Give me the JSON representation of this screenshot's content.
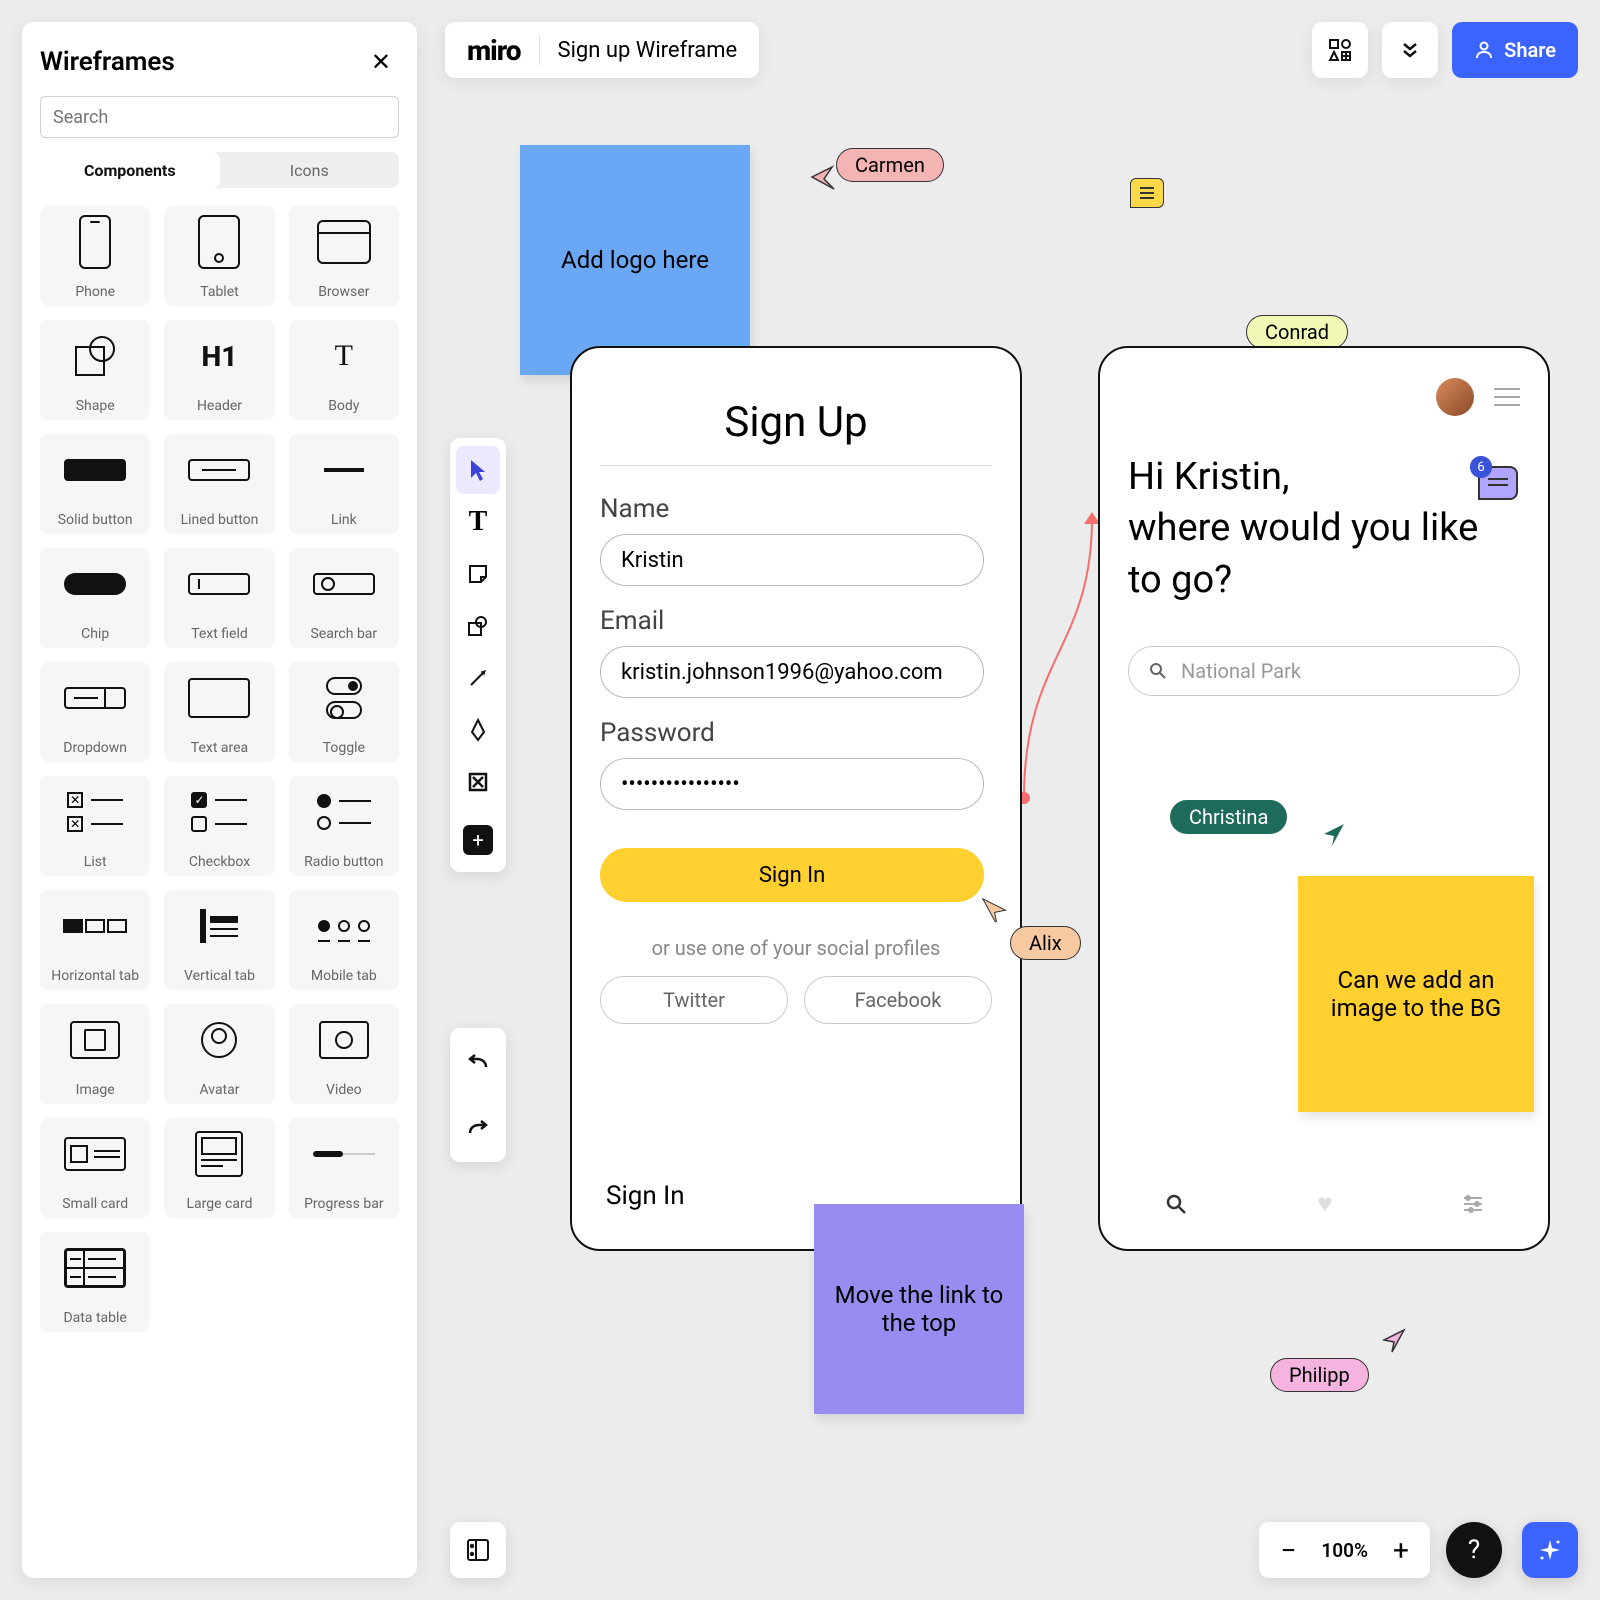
{
  "header": {
    "logo": "miro",
    "doc_title": "Sign up Wireframe",
    "share": "Share"
  },
  "panel": {
    "title": "Wireframes",
    "search_placeholder": "Search",
    "tabs": {
      "components": "Components",
      "icons": "Icons"
    },
    "items": [
      {
        "id": "phone",
        "label": "Phone"
      },
      {
        "id": "tablet",
        "label": "Tablet"
      },
      {
        "id": "browser",
        "label": "Browser"
      },
      {
        "id": "shape",
        "label": "Shape"
      },
      {
        "id": "header",
        "label": "Header"
      },
      {
        "id": "body",
        "label": "Body"
      },
      {
        "id": "solid-button",
        "label": "Solid button"
      },
      {
        "id": "lined-button",
        "label": "Lined button"
      },
      {
        "id": "link",
        "label": "Link"
      },
      {
        "id": "chip",
        "label": "Chip"
      },
      {
        "id": "text-field",
        "label": "Text field"
      },
      {
        "id": "search-bar",
        "label": "Search bar"
      },
      {
        "id": "dropdown",
        "label": "Dropdown"
      },
      {
        "id": "text-area",
        "label": "Text area"
      },
      {
        "id": "toggle",
        "label": "Toggle"
      },
      {
        "id": "list",
        "label": "List"
      },
      {
        "id": "checkbox",
        "label": "Checkbox"
      },
      {
        "id": "radio-button",
        "label": "Radio button"
      },
      {
        "id": "horizontal-tab",
        "label": "Horizontal tab"
      },
      {
        "id": "vertical-tab",
        "label": "Vertical tab"
      },
      {
        "id": "mobile-tab",
        "label": "Mobile tab"
      },
      {
        "id": "image",
        "label": "Image"
      },
      {
        "id": "avatar",
        "label": "Avatar"
      },
      {
        "id": "video",
        "label": "Video"
      },
      {
        "id": "small-card",
        "label": "Small card"
      },
      {
        "id": "large-card",
        "label": "Large card"
      },
      {
        "id": "progress-bar",
        "label": "Progress bar"
      },
      {
        "id": "data-table",
        "label": "Data table"
      }
    ]
  },
  "cursors": {
    "carmen": "Carmen",
    "conrad": "Conrad",
    "alix": "Alix",
    "christina": "Christina",
    "philipp": "Philipp"
  },
  "stickies": {
    "logo": "Add logo here",
    "move_link": "Move the link to the top",
    "bg_image": "Can we add an image to the BG"
  },
  "signup": {
    "title": "Sign Up",
    "name_label": "Name",
    "name_value": "Kristin",
    "email_label": "Email",
    "email_value": "kristin.johnson1996@yahoo.com",
    "password_label": "Password",
    "password_value": "••••••••••••••••",
    "submit": "Sign In",
    "or": "or use one of your social profiles",
    "twitter": "Twitter",
    "facebook": "Facebook",
    "signin_link": "Sign In"
  },
  "home": {
    "greeting": "Hi Kristin,\nwhere would you like to go?",
    "search_placeholder": "National Park",
    "badge_count": "6"
  },
  "zoom": "100%"
}
